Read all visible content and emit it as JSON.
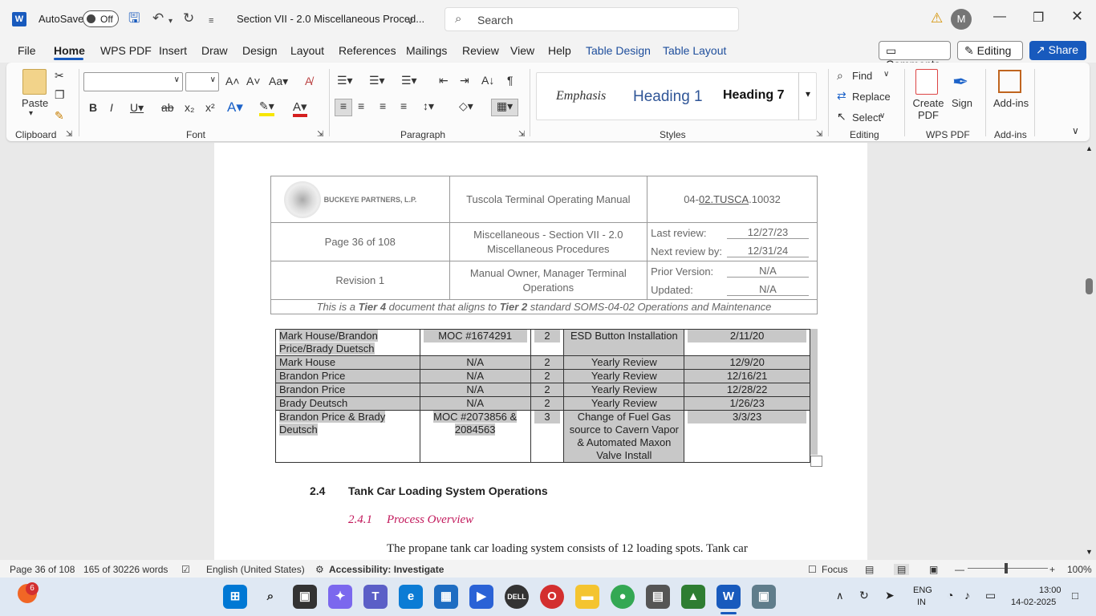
{
  "titlebar": {
    "app_icon": "W",
    "autosave_label": "AutoSave",
    "autosave_state": "Off",
    "doc_title": "Section VII - 2.0 Miscellaneous Proced...",
    "search_placeholder": "Search",
    "avatar_initial": "M"
  },
  "menu": {
    "items": [
      "File",
      "Home",
      "WPS PDF",
      "Insert",
      "Draw",
      "Design",
      "Layout",
      "References",
      "Mailings",
      "Review",
      "View",
      "Help",
      "Table Design",
      "Table Layout"
    ],
    "comments": "Comments",
    "editing": "Editing",
    "share": "Share"
  },
  "ribbon": {
    "paste": "Paste",
    "styles": [
      "Emphasis",
      "Heading 1",
      "Heading 7"
    ],
    "find": "Find",
    "replace": "Replace",
    "select": "Select",
    "create_pdf": "Create PDF",
    "sign": "Sign",
    "addins": "Add-ins",
    "groups": [
      "Clipboard",
      "Font",
      "Paragraph",
      "Styles",
      "Editing",
      "WPS PDF",
      "Add-ins"
    ]
  },
  "doc_header": {
    "company": "BUCKEYE PARTNERS, L.P.",
    "manual": "Tuscola Terminal Operating Manual",
    "doc_code_prefix": "04-",
    "doc_code_link": "02.TUSCA",
    "doc_code_suffix": ".10032",
    "page": "Page 36 of 108",
    "section": "Miscellaneous - Section VII - 2.0 Miscellaneous Procedures",
    "last_review_label": "Last review:",
    "last_review": "12/27/23",
    "next_review_label": "Next review by:",
    "next_review": "12/31/24",
    "revision": "Revision 1",
    "owner": "Manual Owner, Manager Terminal Operations",
    "prior_label": "Prior Version:",
    "prior": "N/A",
    "updated_label": "Updated:",
    "updated": "N/A",
    "tier_a": "This is a ",
    "tier_b": "Tier 4",
    "tier_c": " document that aligns to ",
    "tier_d": "Tier 2",
    "tier_e": " standard SOMS-04-02 Operations and Maintenance"
  },
  "revisions": [
    [
      "Mark House/Brandon Price/Brady Duetsch",
      "MOC #1674291",
      "2",
      "ESD Button Installation",
      "2/11/20"
    ],
    [
      "Mark House",
      "N/A",
      "2",
      "Yearly Review",
      "12/9/20"
    ],
    [
      "Brandon Price",
      "N/A",
      "2",
      "Yearly Review",
      "12/16/21"
    ],
    [
      "Brandon Price",
      "N/A",
      "2",
      "Yearly Review",
      "12/28/22"
    ],
    [
      "Brady Deutsch",
      "N/A",
      "2",
      "Yearly Review",
      "1/26/23"
    ],
    [
      "Brandon Price & Brady Deutsch",
      "MOC #2073856 & 2084563",
      "3",
      "Change of Fuel Gas source to Cavern Vapor & Automated Maxon Valve Install",
      "3/3/23"
    ]
  ],
  "body": {
    "sec_num": "2.4",
    "sec_title": "Tank Car Loading System Operations",
    "sub_num": "2.4.1",
    "sub_title": "Process Overview",
    "para": "The propane tank car loading system consists of 12 loading spots. Tank car"
  },
  "status": {
    "page": "Page 36 of 108",
    "words": "165 of 30226 words",
    "language": "English (United States)",
    "accessibility": "Accessibility: Investigate",
    "focus": "Focus",
    "zoom": "100%"
  },
  "taskbar": {
    "badge": "6",
    "lang1": "ENG",
    "lang2": "IN",
    "time": "13:00",
    "date": "14-02-2025"
  }
}
